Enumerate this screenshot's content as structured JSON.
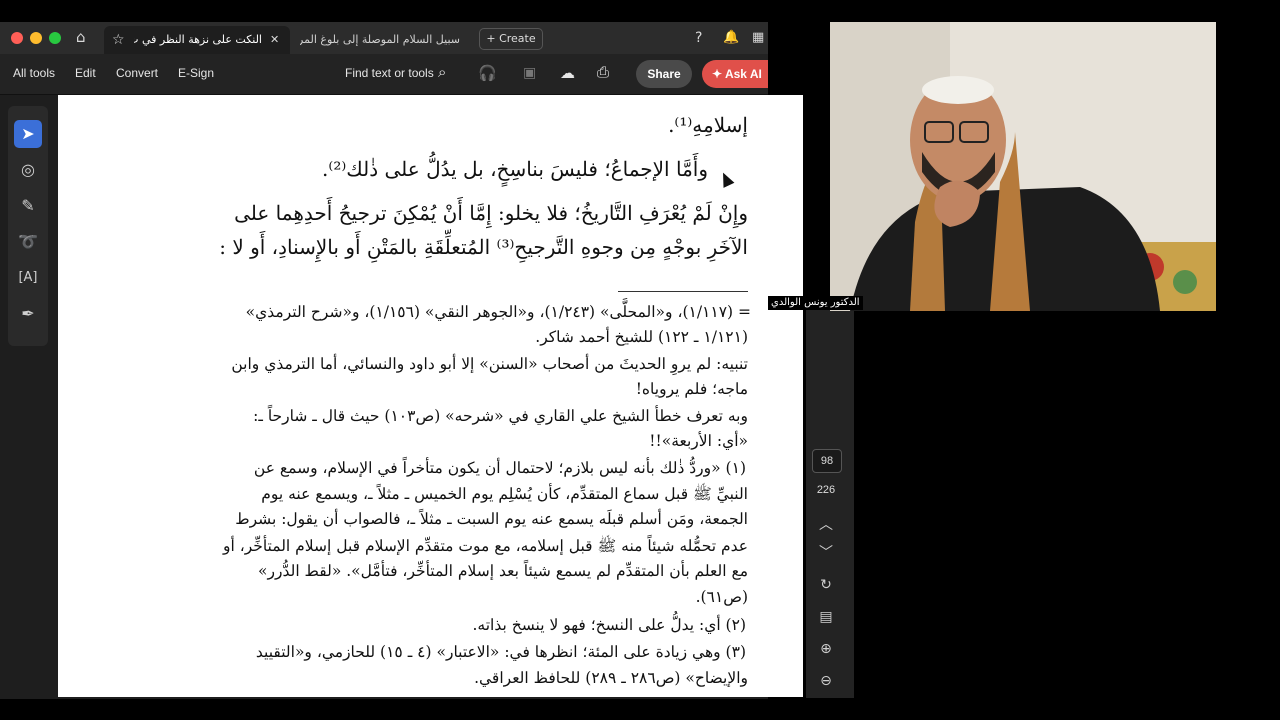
{
  "tabs": [
    {
      "label": "النكت على نزهة النظر في ت..."
    },
    {
      "label": "سبيل السلام الموصلة إلى بلوغ المرام -..."
    }
  ],
  "create_label": "Create",
  "toolbar": {
    "all_tools": "All tools",
    "edit": "Edit",
    "convert": "Convert",
    "esign": "E-Sign",
    "find": "Find text or tools",
    "share": "Share",
    "ask_ai": "Ask AI"
  },
  "document": {
    "lines_main": [
      "إسلامِهِ⁽¹⁾.",
      "وأَمَّا الإجماعُ؛ فليسَ بناسِخٍ، بل يدُلُّ على ذٰلك⁽²⁾.",
      "وإِنْ لَمْ يُعْرَفِ التَّاريخُ؛ فلا يخلو: إِمَّا أَنْ يُمْكِنَ ترجيحُ أَحدِهِما على",
      "الآخَرِ بوجْهٍ مِن وجوهِ التَّرجيحِ⁽³⁾ المُتعلِّقَةِ بالمَتْنِ أَو بالإِسنادِ، أَو لا :"
    ],
    "footnotes": [
      "= (١/١١٧)، و«المحلَّى» (١/٢٤٣)، و«الجوهر النقي» (١/١٥٦)، و«شرح الترمذي»",
      "(١/١٢١ ـ ١٢٢) للشيخ أحمد شاكر.",
      "تنبيه: لم يروِ الحديثَ من أصحاب «السنن» إلا أبو داود والنسائي، أما الترمذي وابن",
      "ماجه؛ فلم يروياه!",
      "وبه تعرف خطأ الشيخ علي القاري في «شرحه» (ص١٠٣) حيث قال ـ شارحاً ـ:",
      "«أي: الأربعة»!!",
      "(١) «وردُّ ذٰلك بأنه ليس بلازم؛ لاحتمال أن يكون متأخراً في الإسلام، وسمع عن",
      "النبيِّ ﷺ قبل سماع المتقدِّم، كأن يُسْلِم يوم الخميس ـ مثلاً ـ، ويسمع عنه يوم",
      "الجمعة، ومَن أسلم قبلَه يسمع عنه يوم السبت ـ مثلاً ـ، فالصواب أن يقول: بشرط",
      "عدم تحمُّله شيئاً منه ﷺ قبل إسلامه، مع موت متقدِّم الإسلام قبل إسلام المتأخِّر، أو",
      "مع العلم بأن المتقدِّم لم يسمع شيئاً بعد إسلام المتأخِّر، فتأمَّل». «لقط الدُّرر»",
      "(ص٦١).",
      "(٢) أي: يدلُّ على النسخ؛ فهو لا ينسخ بذاته.",
      "(٣) وهي زيادة على المئة؛ انظرها في: «الاعتبار» (٤ ـ ١٥) للحازمي، و«التقييد",
      "والإيضاح» (ص٢٨٦ ـ ٢٨٩) للحافظ العراقي."
    ]
  },
  "pager": {
    "current": "98",
    "total": "226"
  },
  "webcam": {
    "name": "الدكتور يونس الوالدي"
  },
  "colors": {
    "accent": "#3b6fd8",
    "ask_ai": "#e0504a"
  }
}
